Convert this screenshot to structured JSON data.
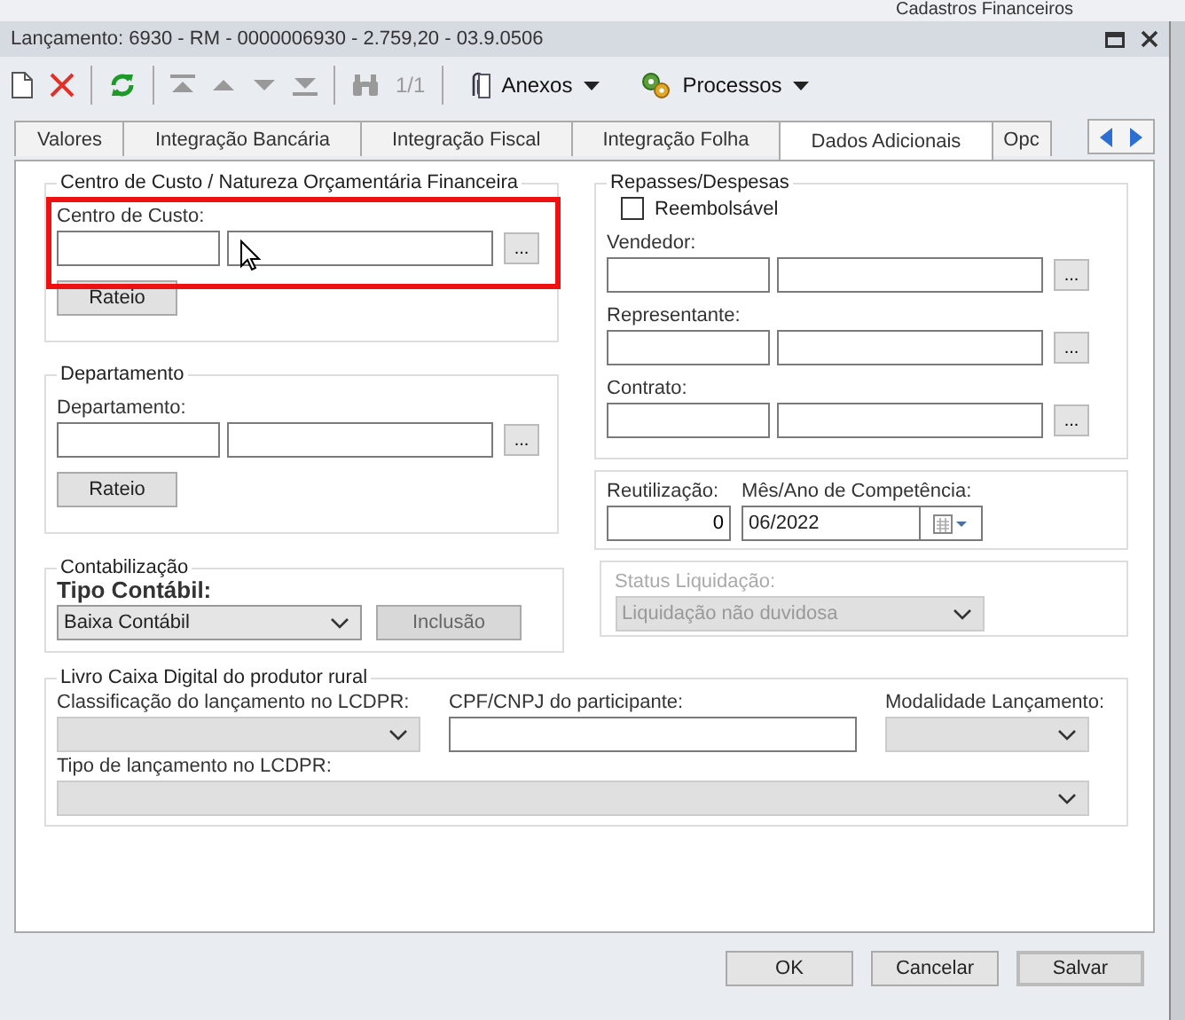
{
  "background_app": {
    "label": "Cadastros Financeiros"
  },
  "window": {
    "title": "Lançamento: 6930 - RM - 0000006930 - 2.759,20 - 03.9.0506"
  },
  "toolbar": {
    "page_counter": "1/1",
    "menus": [
      {
        "kind": "attach",
        "label": "Anexos"
      },
      {
        "kind": "process",
        "label": "Processos"
      }
    ]
  },
  "tabs": [
    {
      "label": "Valores",
      "selected": false
    },
    {
      "label": "Integração Bancária",
      "selected": false
    },
    {
      "label": "Integração Fiscal",
      "selected": false
    },
    {
      "label": "Integração Folha",
      "selected": false
    },
    {
      "label": "Dados Adicionais",
      "selected": true
    },
    {
      "label": "Opc",
      "selected": false
    }
  ],
  "left_groups": [
    {
      "legend": "Centro de Custo / Natureza Orçamentária Financeira",
      "field_label": "Centro de Custo:",
      "lookup_button": "...",
      "rateio_button": "Rateio",
      "highlighted": true
    },
    {
      "legend": "Departamento",
      "field_label": "Departamento:",
      "lookup_button": "...",
      "rateio_button": "Rateio",
      "highlighted": false
    }
  ],
  "repasses": {
    "legend": "Repasses/Despesas",
    "checkbox": {
      "label": "Reembolsável",
      "checked": false
    },
    "fields": [
      {
        "label": "Vendedor:",
        "lookup_button": "..."
      },
      {
        "label": "Representante:",
        "lookup_button": "..."
      },
      {
        "label": "Contrato:",
        "lookup_button": "..."
      }
    ]
  },
  "reutilizacao": {
    "label": "Reutilização:",
    "value": "0"
  },
  "competencia": {
    "label": "Mês/Ano de Competência:",
    "value": "06/2022"
  },
  "contabilizacao": {
    "legend": "Contabilização",
    "field_label": "Tipo Contábil:",
    "value": "Baixa Contábil",
    "button": {
      "label": "Inclusão",
      "disabled": true
    }
  },
  "status_liquidacao": {
    "label": "Status Liquidação:",
    "value": "Liquidação não duvidosa",
    "disabled": true
  },
  "lcdpr": {
    "legend": "Livro Caixa Digital do produtor rural",
    "classificacao": {
      "label": "Classificação do lançamento no LCDPR:",
      "disabled": true
    },
    "cpf": {
      "label": "CPF/CNPJ do participante:"
    },
    "modalidade": {
      "label": "Modalidade Lançamento:",
      "disabled": true
    },
    "tipo": {
      "label": "Tipo de lançamento no LCDPR:",
      "disabled": true
    }
  },
  "footer_buttons": [
    {
      "label": "OK",
      "selected": false
    },
    {
      "label": "Cancelar",
      "selected": false
    },
    {
      "label": "Salvar",
      "selected": true
    }
  ]
}
